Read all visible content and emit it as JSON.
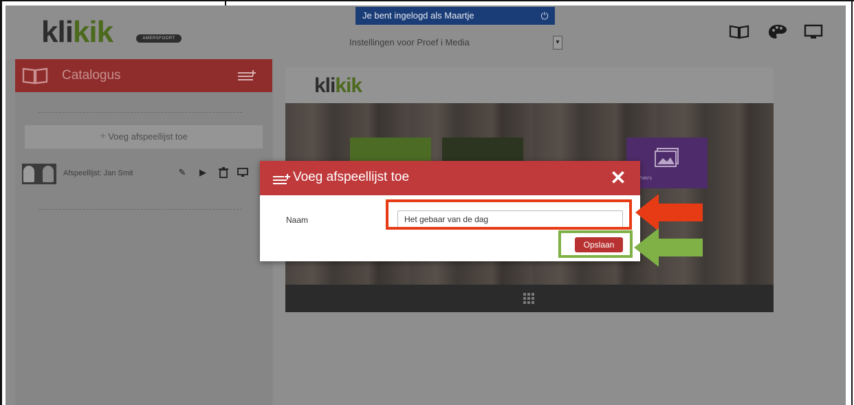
{
  "header": {
    "logo_main": "kli",
    "logo_accent": "kik",
    "logo_badge": "AMERSFOORT",
    "login_text": "Je bent ingelogd als Maartje",
    "settings_text": "Instellingen voor  Proef i Media",
    "icons": [
      "book-icon",
      "palette-icon",
      "monitor-icon"
    ]
  },
  "sidebar": {
    "title": "Catalogus",
    "add_playlist_label": "Voeg afspeellijst toe",
    "playlist": {
      "label": "Afspeellijst: Jan Smit",
      "actions": [
        "edit-icon",
        "play-icon",
        "trash-icon",
        "monitor-icon"
      ]
    }
  },
  "preview": {
    "logo_main": "kli",
    "logo_accent": "kik",
    "photo_tile_label": "Foto's"
  },
  "modal": {
    "title": "Voeg afspeellijst toe",
    "close_glyph": "✕",
    "name_label": "Naam",
    "name_value": "Het gebaar van de dag",
    "save_label": "Opslaan"
  },
  "colors": {
    "header_red": "#c0393b",
    "login_blue": "#1b3d77",
    "highlight_red": "#e63b14",
    "highlight_green": "#7fb146",
    "brand_green": "#4c6a1e"
  }
}
